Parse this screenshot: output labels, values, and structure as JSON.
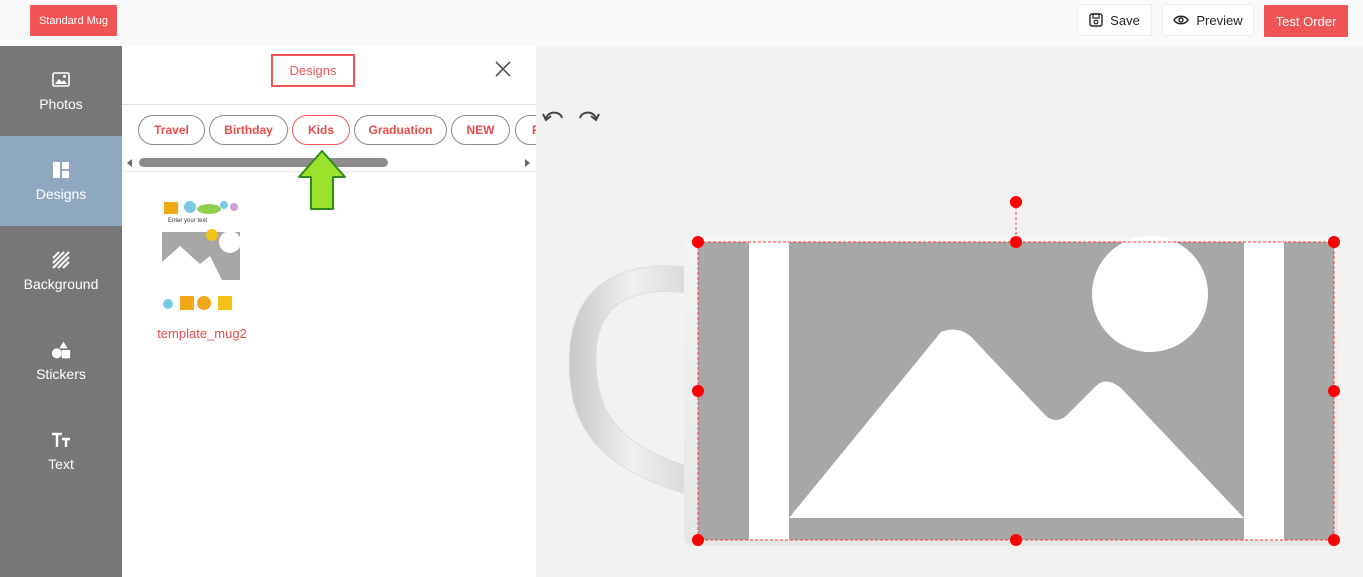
{
  "header": {
    "product_label": "Standard Mug",
    "save_label": "Save",
    "preview_label": "Preview",
    "order_label": "Test Order"
  },
  "sidebar": {
    "items": [
      {
        "label": "Photos",
        "icon": "image-icon"
      },
      {
        "label": "Designs",
        "icon": "layout-icon",
        "active": true
      },
      {
        "label": "Background",
        "icon": "stripes-icon"
      },
      {
        "label": "Stickers",
        "icon": "shapes-icon"
      },
      {
        "label": "Text",
        "icon": "text-icon"
      }
    ]
  },
  "panel": {
    "title": "Designs",
    "categories": [
      "Travel",
      "Birthday",
      "Kids",
      "Graduation",
      "NEW",
      "F"
    ],
    "selected_category": "Kids",
    "templates": [
      {
        "name": "template_mug2",
        "thumb_text": "Enter your text"
      }
    ]
  },
  "colors": {
    "accent": "#f05454",
    "sidebar": "#777777",
    "sidebar_active": "#90a8bf",
    "handle": "#ff0000",
    "hint_arrow": "#9be22d"
  }
}
